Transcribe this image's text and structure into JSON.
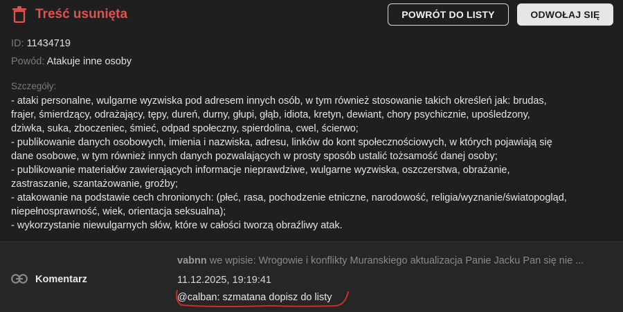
{
  "header": {
    "title": "Treść usunięta",
    "icon": "trash-icon",
    "back_button": "POWRÓT DO LISTY",
    "appeal_button": "ODWOŁAJ SIĘ"
  },
  "meta": {
    "id_label": "ID:",
    "id_value": "11434719",
    "reason_label": "Powód:",
    "reason_value": "Atakuje inne osoby"
  },
  "details": {
    "label": "Szczegóły:",
    "lines": [
      "- ataki personalne, wulgarne wyzwiska pod adresem innych osób, w tym również stosowanie takich określeń jak: brudas,",
      "frajer, śmierdzący, odrażający, tępy, dureń, durny, głupi, głąb, idiota, kretyn, dewiant, chory psychicznie, upośledzony,",
      "dziwka, suka, zboczeniec, śmieć, odpad społeczny, spierdolina, cwel, ścierwo;",
      "- publikowanie danych osobowych, imienia i nazwiska, adresu, linków do kont społecznościowych, w których pojawiają się",
      "dane osobowe, w tym również innych danych pozwalających w prosty sposób ustalić tożsamość danej osoby;",
      "- publikowanie materiałów zawierających informacje nieprawdziwe, wulgarne wyzwiska, oszczerstwa, obrażanie,",
      "zastraszanie, szantażowanie, groźby;",
      "- atakowanie na podstawie cech chronionych: (płeć, rasa, pochodzenie etniczne, narodowość, religia/wyznanie/światopogląd,",
      "niepełnosprawność, wiek, orientacja seksualna);",
      "- wykorzystanie niewulgarnych słów, które w całości tworzą obraźliwy atak."
    ]
  },
  "comment": {
    "icon": "link-icon",
    "label": "Komentarz",
    "author": "vabnn",
    "context": "we wpisie: Wrogowie i konflikty Muranskiego aktualizacja Panie Jacku Pan się nie ...",
    "date": "11.12.2025, 19:19:41",
    "text": "@calban: szmatana dopisz do listy"
  },
  "colors": {
    "background": "#1f1f1f",
    "accent_red": "#e0524f",
    "muted_text": "#7a7a7a"
  }
}
